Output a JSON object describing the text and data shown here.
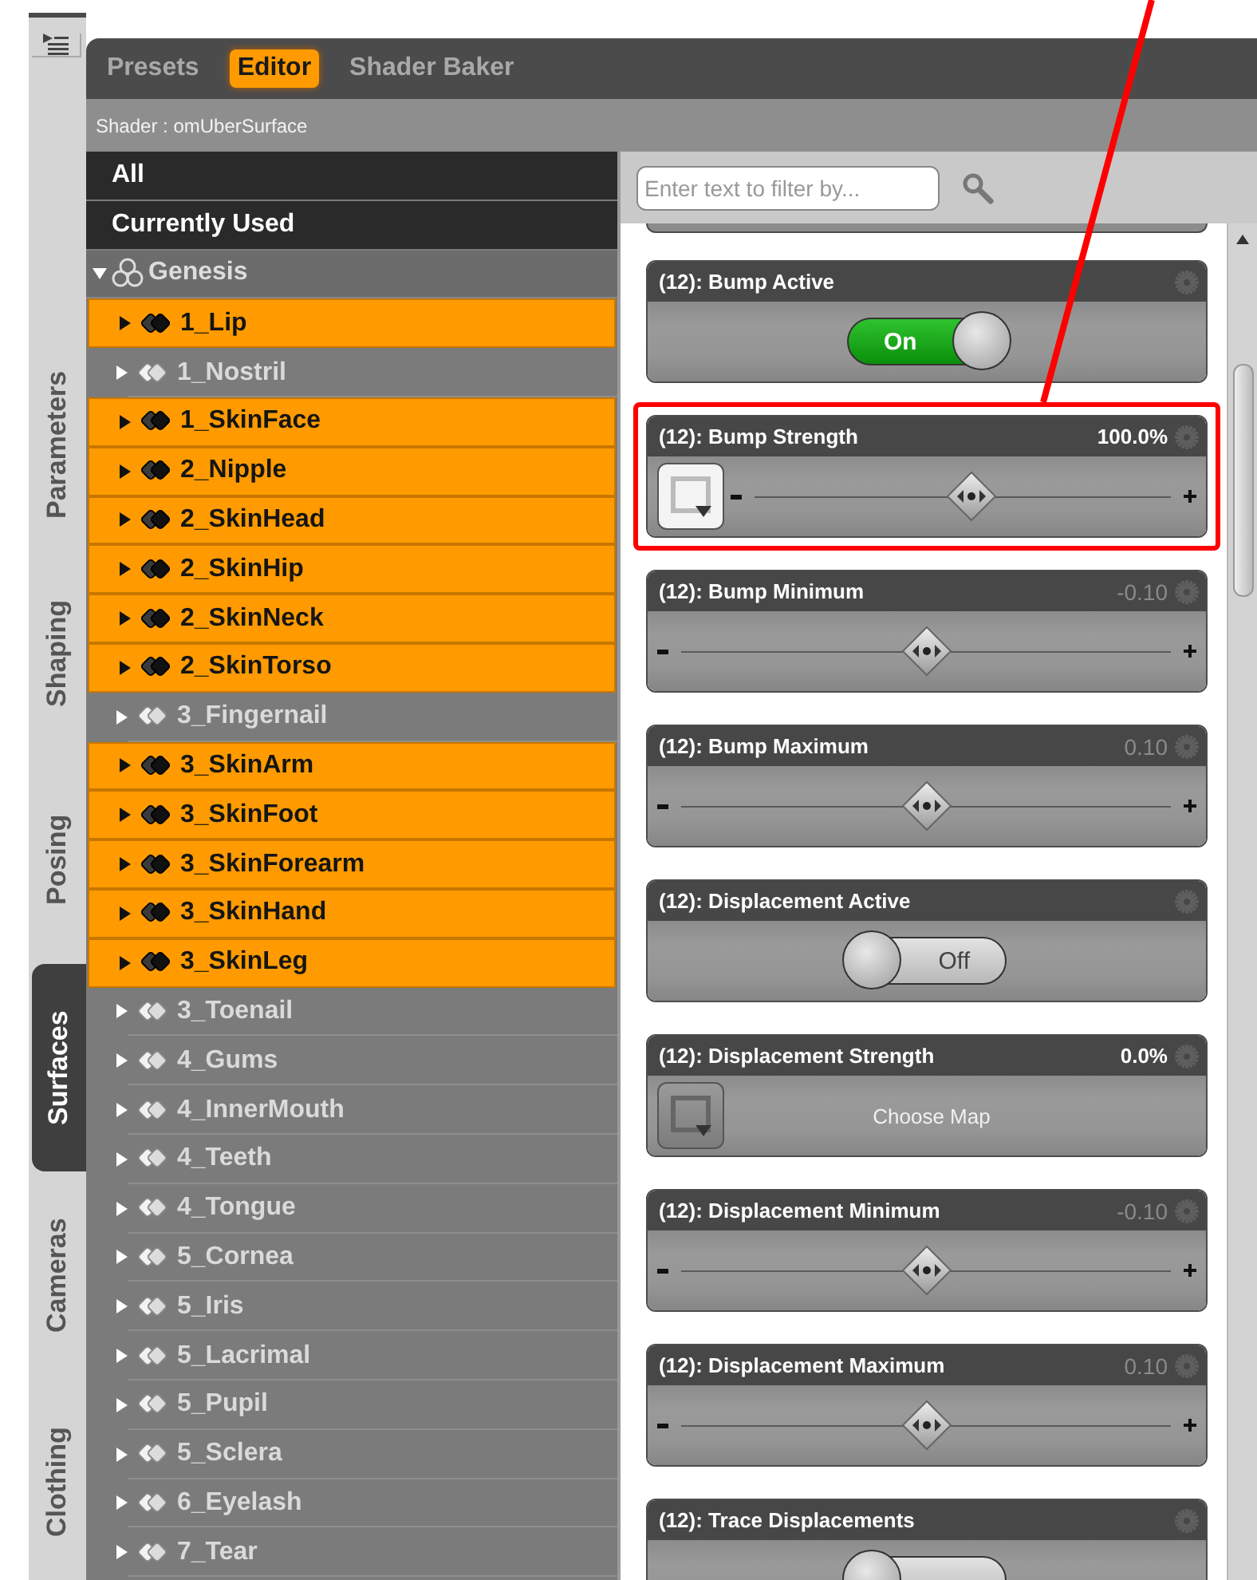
{
  "side_tabs": [
    {
      "label": "Parameters",
      "selected": false
    },
    {
      "label": "Shaping",
      "selected": false
    },
    {
      "label": "Posing",
      "selected": false
    },
    {
      "label": "Surfaces",
      "selected": true
    },
    {
      "label": "Cameras",
      "selected": false
    },
    {
      "label": "Clothing",
      "selected": false
    }
  ],
  "tabs": [
    {
      "label": "Presets",
      "selected": false
    },
    {
      "label": "Editor",
      "selected": true
    },
    {
      "label": "Shader Baker",
      "selected": false
    }
  ],
  "shader_label": "Shader : omUberSurface",
  "surface_tree": {
    "filters": [
      {
        "label": "All"
      },
      {
        "label": "Currently Used"
      }
    ],
    "root": {
      "name": "Genesis",
      "expanded": true,
      "children": [
        {
          "name": "1_Lip",
          "selected": true,
          "expanded": false
        },
        {
          "name": "1_Nostril",
          "selected": false,
          "expanded": false
        },
        {
          "name": "1_SkinFace",
          "selected": true,
          "expanded": false
        },
        {
          "name": "2_Nipple",
          "selected": true,
          "expanded": false
        },
        {
          "name": "2_SkinHead",
          "selected": true,
          "expanded": false
        },
        {
          "name": "2_SkinHip",
          "selected": true,
          "expanded": false
        },
        {
          "name": "2_SkinNeck",
          "selected": true,
          "expanded": false
        },
        {
          "name": "2_SkinTorso",
          "selected": true,
          "expanded": false
        },
        {
          "name": "3_Fingernail",
          "selected": false,
          "expanded": false
        },
        {
          "name": "3_SkinArm",
          "selected": true,
          "expanded": false
        },
        {
          "name": "3_SkinFoot",
          "selected": true,
          "expanded": false
        },
        {
          "name": "3_SkinForearm",
          "selected": true,
          "expanded": false
        },
        {
          "name": "3_SkinHand",
          "selected": true,
          "expanded": false
        },
        {
          "name": "3_SkinLeg",
          "selected": true,
          "expanded": false
        },
        {
          "name": "3_Toenail",
          "selected": false,
          "expanded": false
        },
        {
          "name": "4_Gums",
          "selected": false,
          "expanded": false
        },
        {
          "name": "4_InnerMouth",
          "selected": false,
          "expanded": false
        },
        {
          "name": "4_Teeth",
          "selected": false,
          "expanded": false
        },
        {
          "name": "4_Tongue",
          "selected": false,
          "expanded": false
        },
        {
          "name": "5_Cornea",
          "selected": false,
          "expanded": false
        },
        {
          "name": "5_Iris",
          "selected": false,
          "expanded": false
        },
        {
          "name": "5_Lacrimal",
          "selected": false,
          "expanded": false
        },
        {
          "name": "5_Pupil",
          "selected": false,
          "expanded": false
        },
        {
          "name": "5_Sclera",
          "selected": false,
          "expanded": false
        },
        {
          "name": "6_Eyelash",
          "selected": false,
          "expanded": false
        },
        {
          "name": "7_Tear",
          "selected": false,
          "expanded": false
        }
      ]
    }
  },
  "filter": {
    "placeholder": "Enter text to filter by..."
  },
  "properties": [
    {
      "kind": "toggle",
      "title": "(12): Bump Active",
      "on": true,
      "state_label": "On",
      "highlighted": false
    },
    {
      "kind": "map_slider",
      "title": "(12): Bump Strength",
      "value": "100.0%",
      "value_dimmed": false,
      "level": 0.52,
      "highlighted": true
    },
    {
      "kind": "slider",
      "title": "(12): Bump Minimum",
      "value": "-0.10",
      "value_dimmed": true,
      "level": 0.5,
      "highlighted": false
    },
    {
      "kind": "slider",
      "title": "(12): Bump Maximum",
      "value": "0.10",
      "value_dimmed": true,
      "level": 0.5,
      "highlighted": false
    },
    {
      "kind": "toggle",
      "title": "(12): Displacement Active",
      "on": false,
      "state_label": "Off",
      "highlighted": false
    },
    {
      "kind": "map",
      "title": "(12): Displacement Strength",
      "value": "0.0%",
      "value_dimmed": false,
      "button_label": "Choose Map",
      "highlighted": false
    },
    {
      "kind": "slider",
      "title": "(12): Displacement Minimum",
      "value": "-0.10",
      "value_dimmed": true,
      "level": 0.5,
      "highlighted": false
    },
    {
      "kind": "slider",
      "title": "(12): Displacement Maximum",
      "value": "0.10",
      "value_dimmed": true,
      "level": 0.5,
      "highlighted": false
    },
    {
      "kind": "toggle",
      "title": "(12): Trace Displacements",
      "on": false,
      "highlighted": false
    }
  ]
}
